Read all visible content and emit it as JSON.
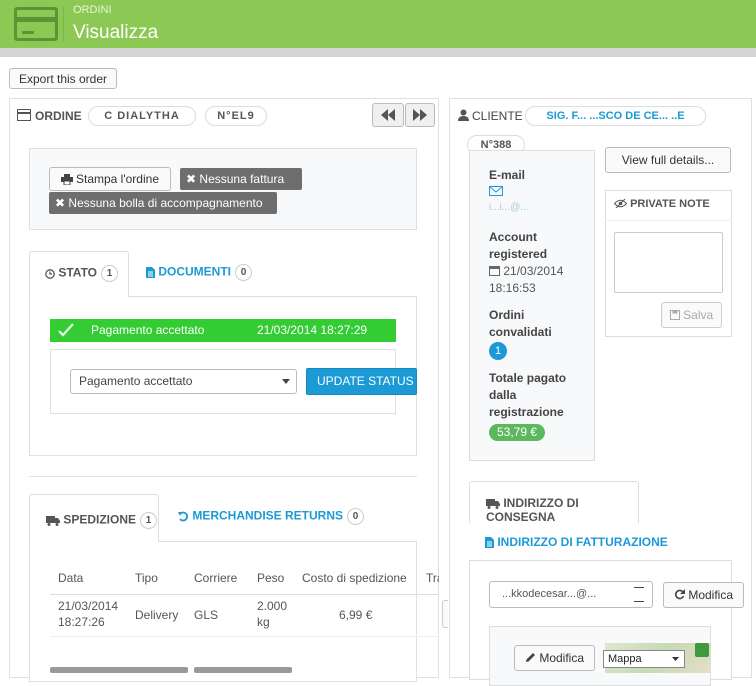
{
  "header": {
    "breadcrumb": "ORDINI",
    "title": "Visualizza"
  },
  "toolbar": {
    "export_label": "Export this order"
  },
  "order_panel": {
    "title": "ORDINE",
    "ref_pill": "C  DIALYTHA",
    "num_pill": "N°EL9"
  },
  "actions": {
    "print": "Stampa l'ordine",
    "no_invoice": "Nessuna fattura",
    "no_delivery": "Nessuna bolla di accompagnamento"
  },
  "tabs1": {
    "stato": "STATO",
    "stato_count": "1",
    "documenti": "DOCUMENTI",
    "documenti_count": "0"
  },
  "status_row": {
    "label": "Pagamento accettato",
    "date": "21/03/2014 18:27:29",
    "color": "#33cc33"
  },
  "status_select": {
    "value": "Pagamento accettato",
    "button": "UPDATE STATUS"
  },
  "tabs2": {
    "spedizione": "SPEDIZIONE",
    "spedizione_count": "1",
    "returns": "MERCHANDISE RETURNS",
    "returns_count": "0"
  },
  "shipping_table": {
    "headers": [
      "Data",
      "Tipo",
      "Corriere",
      "Peso",
      "Costo di spedizione",
      "Trac"
    ],
    "rows": [
      {
        "date": "21/03/2014",
        "time": "18:27:26",
        "type": "Delivery",
        "carrier": "GLS",
        "weight": "2.000",
        "unit": "kg",
        "cost": "6,99 €"
      }
    ]
  },
  "customer_panel": {
    "title": "CLIENTE",
    "name_pill": "SIG. F... ...SCO DE CE... ..E",
    "num_pill": "N°388"
  },
  "customer_info": {
    "email_label": "E-mail",
    "email_value": "i...i...@...",
    "account_label": "Account registered",
    "account_date": "21/03/2014",
    "account_time": "18:16:53",
    "orders_label": "Ordini convalidati",
    "orders_count": "1",
    "total_label": "Totale pagato dalla registrazione",
    "total_value": "53,79 €"
  },
  "full_details": "View full details...",
  "private_note": {
    "title": "PRIVATE NOTE",
    "save": "Salva"
  },
  "address": {
    "tab_delivery": "INDIRIZZO DI CONSEGNA",
    "tab_billing": "INDIRIZZO DI FATTURAZIONE",
    "select_value": "...kkodecesar...@...",
    "modify": "Modifica",
    "modify2": "Modifica",
    "map_select": "Mappa"
  },
  "colors": {
    "header": "#8bc954",
    "accent": "#1b9ad6",
    "status": "#33cc33",
    "total": "#5cb85c"
  }
}
